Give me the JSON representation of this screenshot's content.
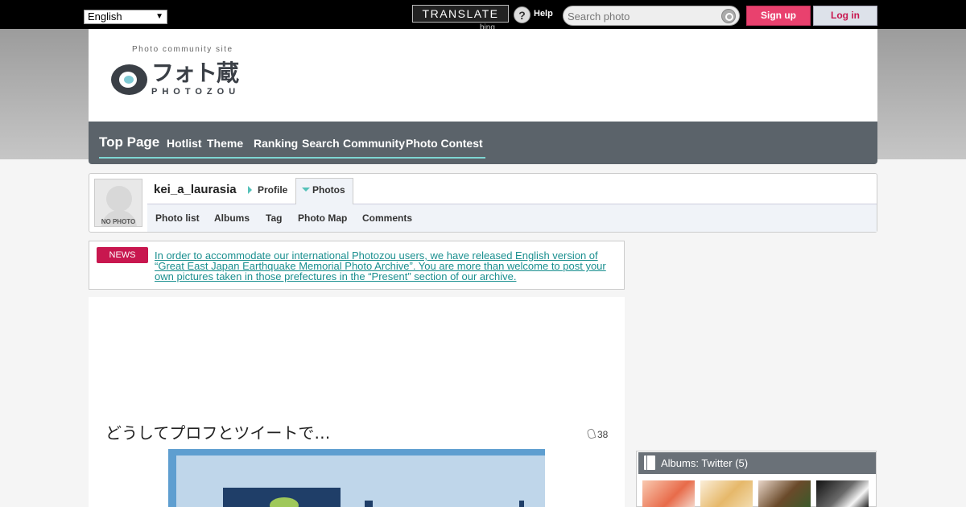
{
  "topbar": {
    "language": "English",
    "translate_label": "TRANSLATE",
    "bing_label": "bing",
    "help_label": "Help",
    "search_placeholder": "Search photo",
    "signup_label": "Sign up",
    "login_label": "Log in"
  },
  "header": {
    "tagline": "Photo community site",
    "logo_text": "フォト蔵",
    "logo_sub": "PHOTOZOU"
  },
  "nav": {
    "items": [
      "Top Page",
      "Hotlist",
      "Theme",
      "Ranking",
      "Search",
      "Community",
      "Photo Contest"
    ]
  },
  "user": {
    "avatar_label": "NO PHOTO",
    "username": "kei_a_laurasia",
    "profile_label": "Profile",
    "photos_label": "Photos",
    "sub_links": [
      "Photo list",
      "Albums",
      "Tag",
      "Photo Map",
      "Comments"
    ]
  },
  "news": {
    "badge": "NEWS",
    "text": "In order to accommodate our international Photozou users, we have released English version of “Great East Japan Earthquake Memorial Photo Archive”. You are more than welcome to post your own pictures taken in those prefectures in the “Present” section of our archive."
  },
  "photo": {
    "title": "どうしてプロフとツイートで…",
    "favorites": "38"
  },
  "albums": {
    "title": "Albums: Twitter (5)"
  },
  "colors": {
    "signup": "#e9416e",
    "login_text": "#c8174f",
    "nav_bg": "#5b636a",
    "accent": "#7ed6d3",
    "news_badge": "#c8174f",
    "link": "#1a8f8f"
  }
}
